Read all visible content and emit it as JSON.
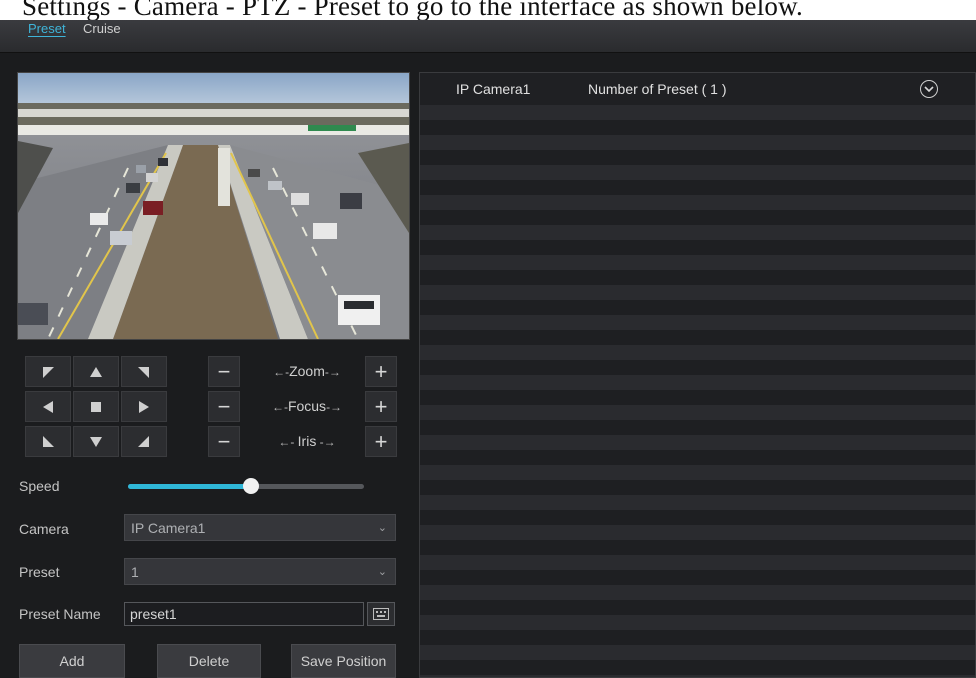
{
  "caption": {
    "text": "Settings - Camera - PTZ - Preset to go to the interface as shown below."
  },
  "tabs": [
    {
      "label": "Preset",
      "active": true
    },
    {
      "label": "Cruise",
      "active": false
    }
  ],
  "ptz": {
    "zoom_label": "Zoom",
    "focus_label": "Focus",
    "iris_label": "Iris"
  },
  "speed": {
    "label": "Speed",
    "value_fraction": 0.52
  },
  "form": {
    "camera_label": "Camera",
    "camera_value": "IP Camera1",
    "preset_label": "Preset",
    "preset_value": "1",
    "preset_name_label": "Preset Name",
    "preset_name_value": "preset1"
  },
  "buttons": {
    "add": "Add",
    "delete": "Delete",
    "save_position": "Save Position"
  },
  "preset_list": {
    "camera": "IP Camera1",
    "count_text": "Number of Preset ( 1 )"
  },
  "colors": {
    "accent": "#2fb7d8",
    "background": "#1b1c1e"
  }
}
